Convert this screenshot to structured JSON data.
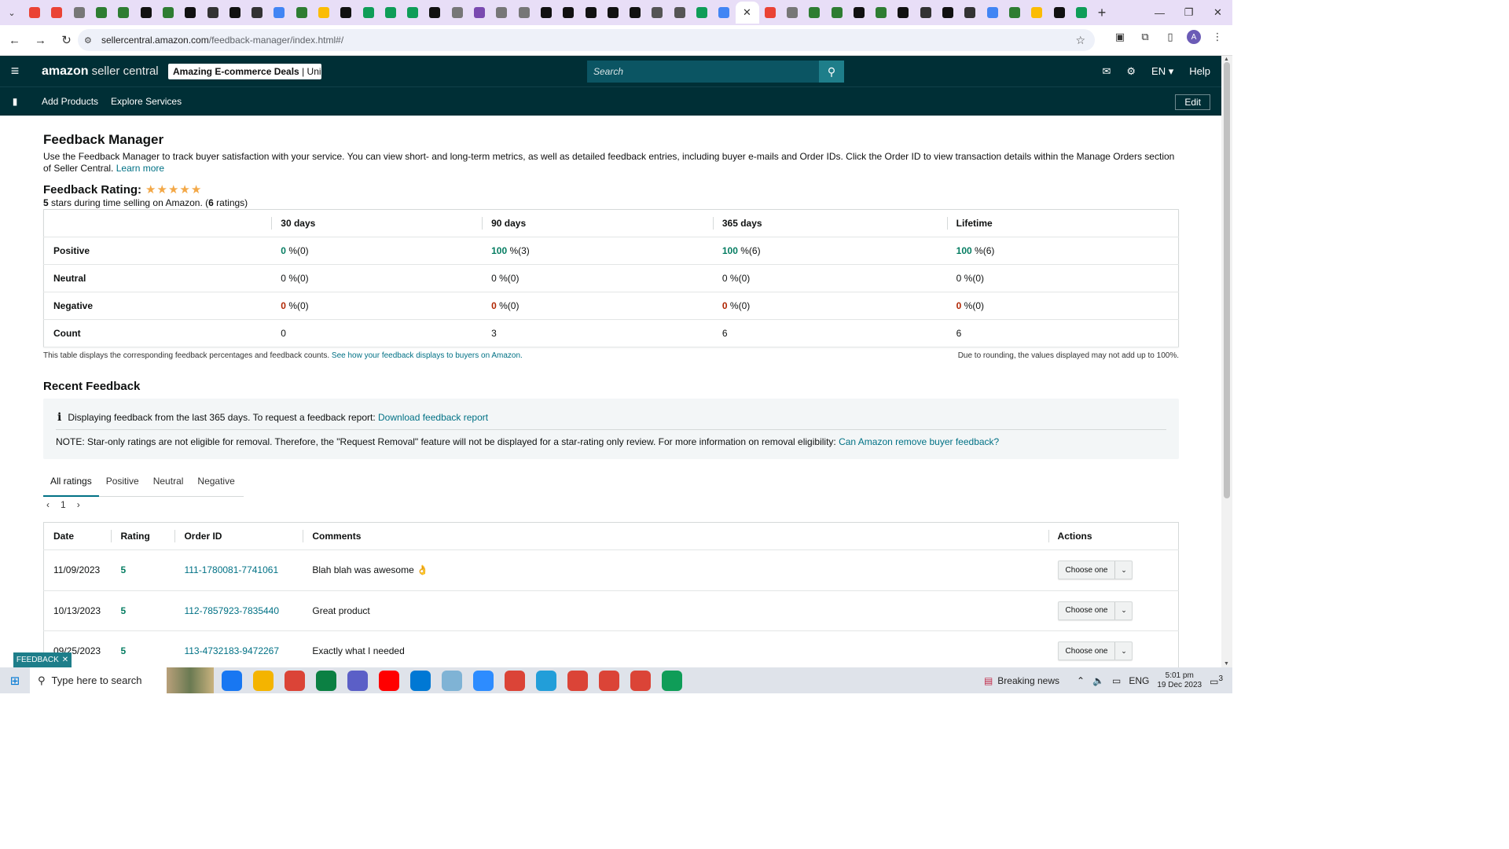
{
  "browser": {
    "tab_count": 49,
    "active_tab_close": "✕",
    "new_tab": "+",
    "url_host": "sellercentral.amazon.com",
    "url_path": "/feedback-manager/index.html#/",
    "profile_initial": "A"
  },
  "header": {
    "logo_brand": "amazon",
    "logo_product": "seller central",
    "account_name": "Amazing E-commerce Deals",
    "account_marketplace": "| Uni...",
    "search_placeholder": "Search",
    "lang": "EN",
    "help": "Help"
  },
  "nav": {
    "links": [
      "Add Products",
      "Explore Services"
    ],
    "edit_label": "Edit"
  },
  "page": {
    "title": "Feedback Manager",
    "intro": "Use the Feedback Manager to track buyer satisfaction with your service. You can view short- and long-term metrics, as well as detailed feedback entries, including buyer e-mails and Order IDs. Click the Order ID to view transaction details within the Manage Orders section of Seller Central.",
    "learn_more": "Learn more",
    "rating_title": "Feedback Rating:",
    "rating_stars": 5,
    "rating_sub_stars": "5",
    "rating_sub_text": "stars during time selling on Amazon. (",
    "rating_sub_count": "6",
    "rating_sub_tail": "ratings)"
  },
  "metrics": {
    "columns": [
      "30 days",
      "90 days",
      "365 days",
      "Lifetime"
    ],
    "rows": [
      {
        "label": "Positive",
        "cells": [
          [
            "0",
            " %(0)"
          ],
          [
            "100",
            " %(3)"
          ],
          [
            "100",
            " %(6)"
          ],
          [
            "100",
            " %(6)"
          ]
        ]
      },
      {
        "label": "Neutral",
        "cells": [
          [
            "0",
            " %(0)"
          ],
          [
            "0",
            " %(0)"
          ],
          [
            "0",
            " %(0)"
          ],
          [
            "0",
            " %(0)"
          ]
        ]
      },
      {
        "label": "Negative",
        "cells": [
          [
            "0",
            " %(0)"
          ],
          [
            "0",
            " %(0)"
          ],
          [
            "0",
            " %(0)"
          ],
          [
            "0",
            " %(0)"
          ]
        ]
      },
      {
        "label": "Count",
        "cells": [
          [
            "0"
          ],
          [
            "3"
          ],
          [
            "6"
          ],
          [
            "6"
          ]
        ]
      }
    ],
    "footnote": "This table displays the corresponding feedback percentages and feedback counts.",
    "footnote_link": "See how your feedback displays to buyers on Amazon.",
    "rounding_note": "Due to rounding, the values displayed may not add up to 100%."
  },
  "recent": {
    "title": "Recent Feedback",
    "info_icon": "i",
    "info_text": "Displaying feedback from the last 365 days. To request a feedback report:",
    "info_link": "Download feedback report",
    "note_text": "NOTE: Star-only ratings are not eligible for removal. Therefore, the \"Request Removal\" feature will not be displayed for a star-rating only review. For more information on removal eligibility:",
    "note_link": "Can Amazon remove buyer feedback?",
    "tabs": [
      "All ratings",
      "Positive",
      "Neutral",
      "Negative"
    ],
    "page": "1",
    "columns": [
      "Date",
      "Rating",
      "Order ID",
      "Comments",
      "Actions"
    ],
    "rows": [
      {
        "date": "11/09/2023",
        "rating": "5",
        "order_id": "111-1780081-7741061",
        "comment": "Blah blah was awesome 👌",
        "action": "Choose one"
      },
      {
        "date": "10/13/2023",
        "rating": "5",
        "order_id": "112-7857923-7835440",
        "comment": "Great product",
        "action": "Choose one"
      },
      {
        "date": "09/25/2023",
        "rating": "5",
        "order_id": "113-4732183-9472267",
        "comment": "Exactly what I needed",
        "action": "Choose one"
      }
    ]
  },
  "feedback_tab": {
    "label": "FEEDBACK",
    "close": "✕"
  },
  "taskbar": {
    "search_placeholder": "Type here to search",
    "news": "Breaking news",
    "lang": "ENG",
    "time": "5:01 pm",
    "date": "19 Dec 2023",
    "notif_count": "3"
  },
  "colors": {
    "header_bg": "#002f36",
    "link": "#007185",
    "positive": "#067d62",
    "negative": "#b12704",
    "star": "#f3a847"
  }
}
